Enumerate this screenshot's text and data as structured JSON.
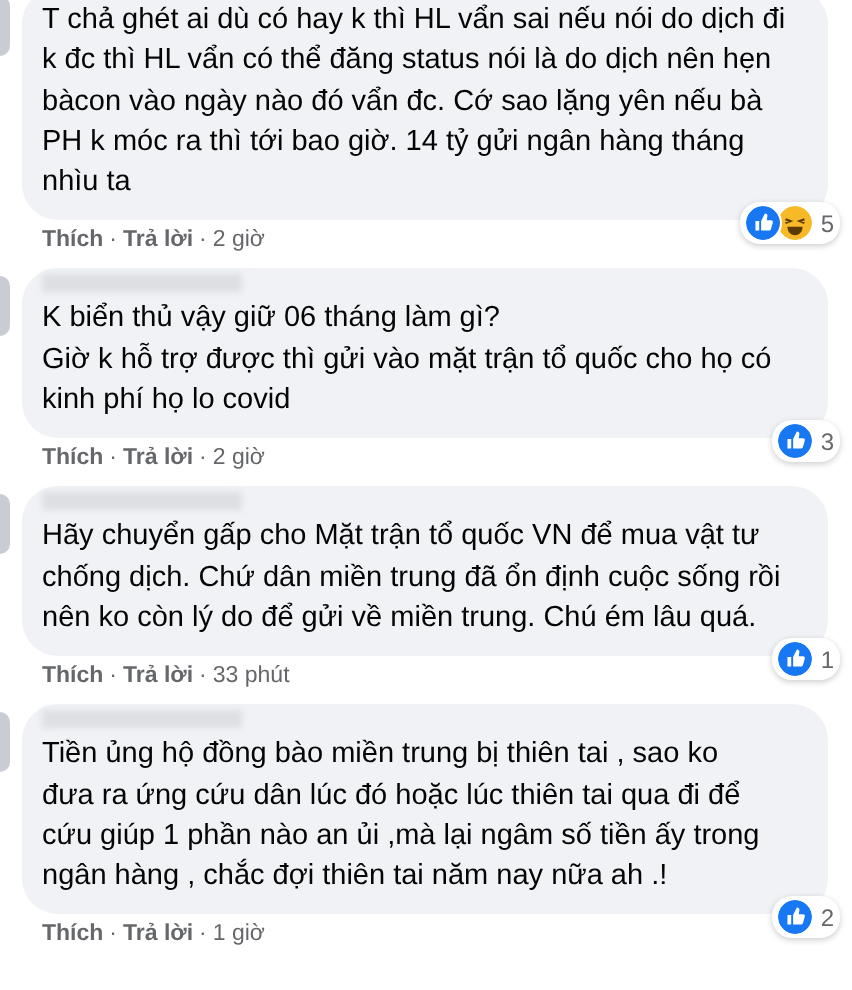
{
  "comments": [
    {
      "name_blurred": false,
      "text": "T chả ghét ai dù có hay k thì HL vẩn sai nếu nói do dịch đi\nk đc thì HL vẩn có thể đăng status nói là do dịch nên hẹn\nbàcon vào ngày nào đó vẩn đc. Cớ sao lặng yên nếu bà\nPH k móc ra thì tới bao giờ. 14 tỷ gửi ngân hàng tháng\nnhìu ta",
      "reactions": [
        {
          "kind": "like"
        },
        {
          "kind": "haha"
        }
      ],
      "reaction_count": "5",
      "actions": [
        {
          "kind": "like",
          "text": "Thích"
        },
        {
          "kind": "dot",
          "text": "·"
        },
        {
          "kind": "reply",
          "text": "Trả lời"
        },
        {
          "kind": "dot",
          "text": "·"
        },
        {
          "kind": "time",
          "text": "2 giờ"
        }
      ]
    },
    {
      "name_blurred": true,
      "text": "K biển thủ vậy giữ 06 tháng làm gì?\nGiờ k hỗ trợ được thì gửi vào mặt trận tổ quốc cho họ có\nkinh phí họ lo covid",
      "reactions": [
        {
          "kind": "like"
        }
      ],
      "reaction_count": "3",
      "actions": [
        {
          "kind": "like",
          "text": "Thích"
        },
        {
          "kind": "dot",
          "text": "·"
        },
        {
          "kind": "reply",
          "text": "Trả lời"
        },
        {
          "kind": "dot",
          "text": "·"
        },
        {
          "kind": "time",
          "text": "2 giờ"
        }
      ]
    },
    {
      "name_blurred": true,
      "text": "Hãy chuyển gấp cho Mặt trận tổ quốc VN để mua vật tư\nchống dịch. Chứ dân miền trung đã ổn định cuộc sống rồi\nnên ko còn lý do để gửi về miền trung. Chú ém lâu quá.",
      "reactions": [
        {
          "kind": "like"
        }
      ],
      "reaction_count": "1",
      "actions": [
        {
          "kind": "like",
          "text": "Thích"
        },
        {
          "kind": "dot",
          "text": "·"
        },
        {
          "kind": "reply",
          "text": "Trả lời"
        },
        {
          "kind": "dot",
          "text": "·"
        },
        {
          "kind": "time",
          "text": "33 phút"
        }
      ]
    },
    {
      "name_blurred": true,
      "text": "Tiền ủng hộ đồng bào miền trung bị thiên tai , sao ko\nđưa ra ứng cứu dân lúc đó hoặc lúc thiên tai qua đi để\ncứu giúp 1 phần nào an ủi ,mà lại ngâm số tiền ấy trong\nngân hàng , chắc đợi thiên tai năm nay nữa ah .!",
      "reactions": [
        {
          "kind": "like"
        }
      ],
      "reaction_count": "2",
      "actions": [
        {
          "kind": "like",
          "text": "Thích"
        },
        {
          "kind": "dot",
          "text": "·"
        },
        {
          "kind": "reply",
          "text": "Trả lời"
        },
        {
          "kind": "dot",
          "text": "·"
        },
        {
          "kind": "time",
          "text": "1 giờ"
        }
      ]
    }
  ]
}
